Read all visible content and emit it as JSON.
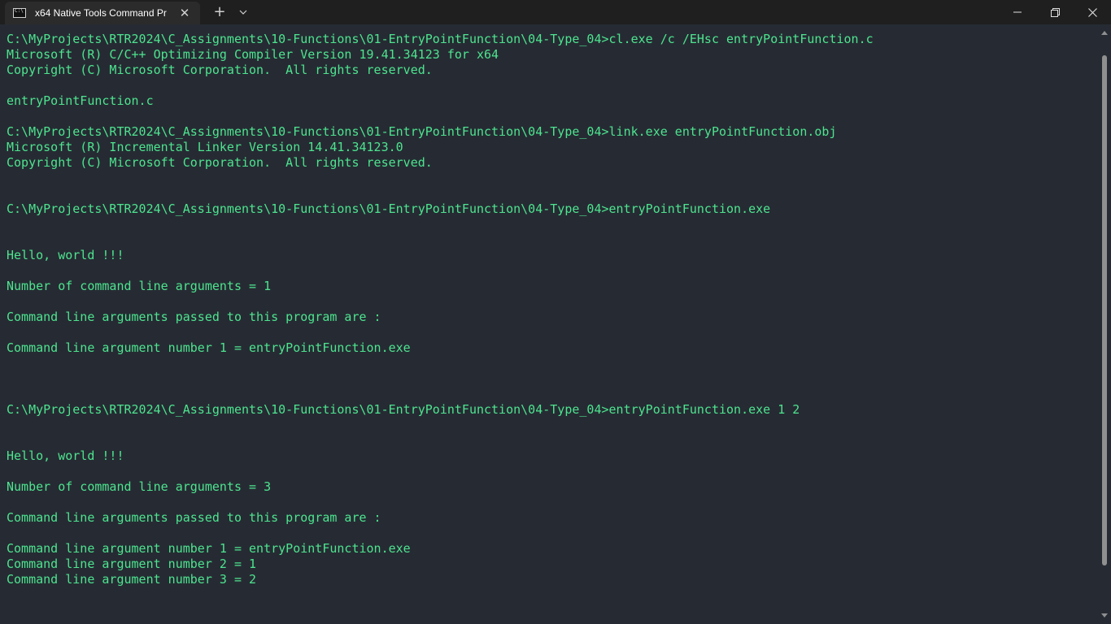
{
  "titlebar": {
    "tab_title": "x64 Native Tools Command Pr",
    "close_tab_glyph": "✕",
    "new_tab_glyph": "+",
    "icons": {
      "tab_icon": "command-prompt-icon",
      "dropdown": "chevron-down-icon",
      "minimize": "minimize-icon",
      "maximize": "restore-icon",
      "close": "close-icon"
    }
  },
  "terminal": {
    "text_color": "#4de48f",
    "background": "#262b33",
    "lines": [
      "C:\\MyProjects\\RTR2024\\C_Assignments\\10-Functions\\01-EntryPointFunction\\04-Type_04>cl.exe /c /EHsc entryPointFunction.c",
      "Microsoft (R) C/C++ Optimizing Compiler Version 19.41.34123 for x64",
      "Copyright (C) Microsoft Corporation.  All rights reserved.",
      "",
      "entryPointFunction.c",
      "",
      "C:\\MyProjects\\RTR2024\\C_Assignments\\10-Functions\\01-EntryPointFunction\\04-Type_04>link.exe entryPointFunction.obj",
      "Microsoft (R) Incremental Linker Version 14.41.34123.0",
      "Copyright (C) Microsoft Corporation.  All rights reserved.",
      "",
      "",
      "C:\\MyProjects\\RTR2024\\C_Assignments\\10-Functions\\01-EntryPointFunction\\04-Type_04>entryPointFunction.exe",
      "",
      "",
      "Hello, world !!!",
      "",
      "Number of command line arguments = 1",
      "",
      "Command line arguments passed to this program are :",
      "",
      "Command line argument number 1 = entryPointFunction.exe",
      "",
      "",
      "",
      "C:\\MyProjects\\RTR2024\\C_Assignments\\10-Functions\\01-EntryPointFunction\\04-Type_04>entryPointFunction.exe 1 2",
      "",
      "",
      "Hello, world !!!",
      "",
      "Number of command line arguments = 3",
      "",
      "Command line arguments passed to this program are :",
      "",
      "Command line argument number 1 = entryPointFunction.exe",
      "Command line argument number 2 = 1",
      "Command line argument number 3 = 2"
    ]
  }
}
